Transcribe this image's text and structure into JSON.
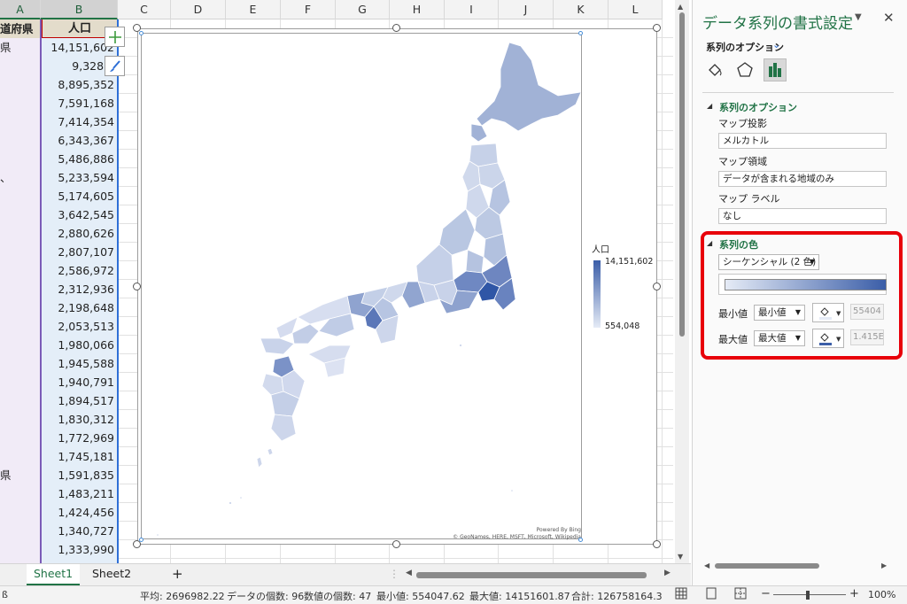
{
  "columns": [
    "A",
    "B",
    "C",
    "D",
    "E",
    "F",
    "G",
    "H",
    "I",
    "J",
    "K",
    "L"
  ],
  "sheet": {
    "header_a": "道府県",
    "header_b": "人口",
    "col_a_visible": [
      "",
      "県",
      "",
      "",
      "",
      "",
      "",
      "",
      "、",
      "",
      "",
      "",
      "",
      "",
      "",
      "",
      "",
      "",
      "",
      "",
      "",
      "",
      "",
      "",
      "県",
      "",
      "",
      "",
      ""
    ],
    "col_b_values": [
      "14,151,602",
      "9,328,7",
      "8,895,352",
      "7,591,168",
      "7,414,354",
      "6,343,367",
      "5,486,886",
      "5,233,594",
      "5,174,605",
      "3,642,545",
      "2,880,626",
      "2,807,107",
      "2,586,972",
      "2,312,936",
      "2,198,648",
      "2,053,513",
      "1,980,066",
      "1,945,588",
      "1,940,791",
      "1,894,517",
      "1,830,312",
      "1,772,969",
      "1,745,181",
      "1,591,835",
      "1,483,211",
      "1,424,456",
      "1,340,727",
      "1,333,990"
    ]
  },
  "chart": {
    "legend_title": "人口",
    "legend_max": "14,151,602",
    "legend_min": "554,048",
    "credit_line1": "Powered By Bing",
    "credit_line2": "© GeoNames, HERE, MSFT, Microsoft, Wikipedia"
  },
  "tabs": [
    "Sheet1",
    "Sheet2"
  ],
  "add_sheet": "+",
  "status": {
    "left_icon": "ß",
    "average": "平均: 2696982.22",
    "count": "データの個数: 96",
    "numeric_count": "数値の個数: 47",
    "min": "最小値: 554047.62",
    "max": "最大値: 14151601.87",
    "sum": "合計: 126758164.3",
    "zoom": "100%",
    "zoom_minus": "−",
    "zoom_plus": "+"
  },
  "pane": {
    "title": "データ系列の書式設定",
    "subtitle": "系列のオプション",
    "section_options": "系列のオプション",
    "projection_label": "マップ投影",
    "projection_value": "メルカトル",
    "area_label": "マップ領域",
    "area_value": "データが含まれる地域のみ",
    "labels_label": "マップ ラベル",
    "labels_value": "なし",
    "section_color": "系列の色",
    "color_type": "シーケンシャル (2 色)",
    "min_label": "最小値",
    "min_dropdown": "最小値",
    "min_value": "55404",
    "max_label": "最大値",
    "max_dropdown": "最大値",
    "max_value": "1.415E",
    "colors": {
      "min_color": "#e5ebf6",
      "max_color": "#3b5ea8",
      "accent": "#217346",
      "highlight": "#e8000a"
    }
  }
}
